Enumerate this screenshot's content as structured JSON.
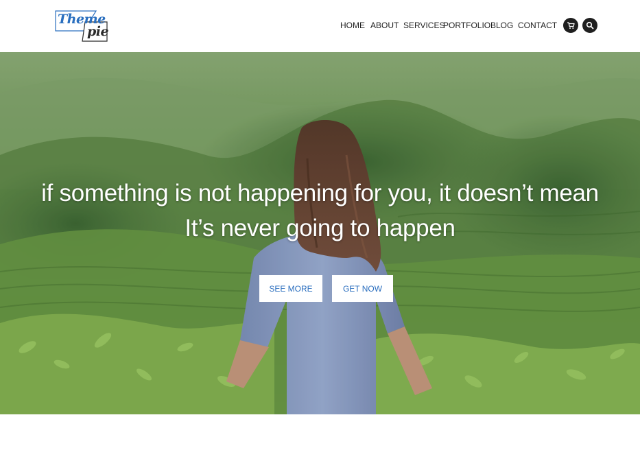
{
  "logo": {
    "line1": "Theme",
    "line2": "pie"
  },
  "nav": {
    "items": [
      {
        "label": "HOME"
      },
      {
        "label": "ABOUT"
      },
      {
        "label": "SERVICES"
      },
      {
        "label": "PORTFOLIO"
      },
      {
        "label": "BLOG"
      },
      {
        "label": "CONTACT"
      }
    ],
    "icons": [
      "cart-icon",
      "search-icon"
    ]
  },
  "hero": {
    "headline_line1": "if something is not happening for you, it doesn’t mean",
    "headline_line2": "It’s never going to happen",
    "buttons": {
      "see_more": "SEE MORE",
      "get_now": "GET NOW"
    },
    "colors": {
      "button_text": "#2c6fbf",
      "button_bg": "#ffffff",
      "headline": "#ffffff"
    }
  }
}
